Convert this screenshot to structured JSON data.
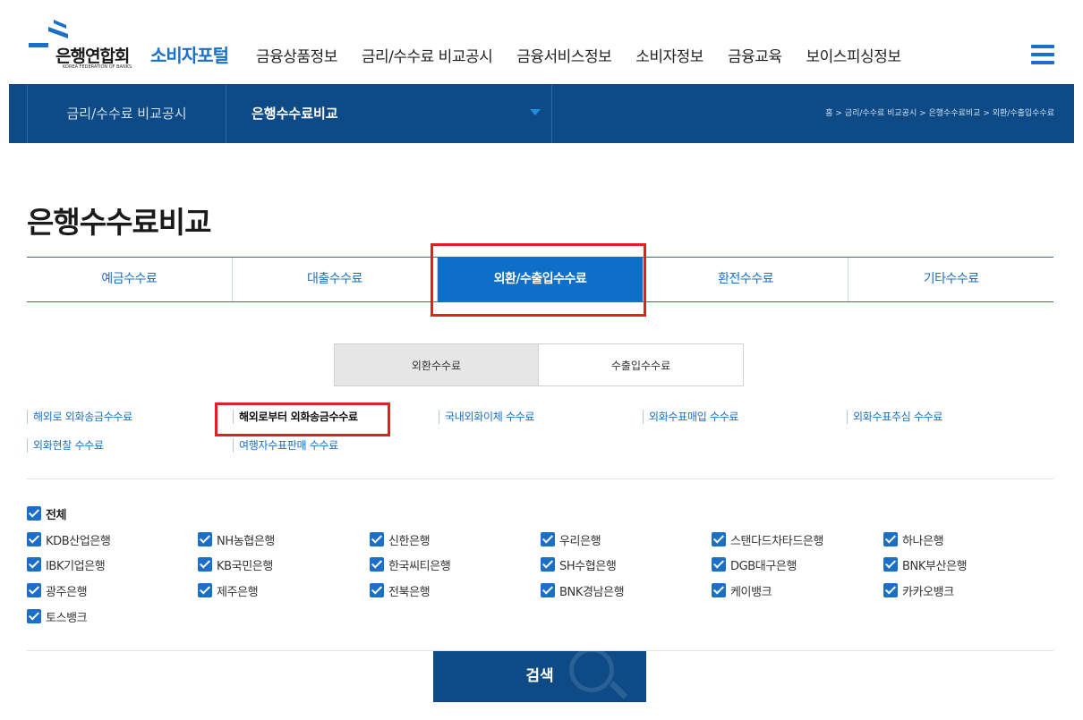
{
  "header": {
    "logo_korean": "은행연합회",
    "logo_english": "KOREA FEDERATION OF BANKS",
    "logo_portal": "소비자포털",
    "menu": [
      "금융상품정보",
      "금리/수수료 비교공시",
      "금융서비스정보",
      "소비자정보",
      "금융교육",
      "보이스피싱정보"
    ],
    "menu_icon": "hamburger-icon"
  },
  "subnav": {
    "section": "금리/수수료 비교공시",
    "subsection": "은행수수료비교",
    "breadcrumb": "홈 > 금리/수수료 비교공시 > 은행수수료비교 > 외환/수출입수수료"
  },
  "page_title": "은행수수료비교",
  "main_tabs": [
    {
      "label": "예금수수료",
      "active": false
    },
    {
      "label": "대출수수료",
      "active": false
    },
    {
      "label": "외환/수출입수수료",
      "active": true
    },
    {
      "label": "환전수수료",
      "active": false
    },
    {
      "label": "기타수수료",
      "active": false
    }
  ],
  "sub_tabs": [
    {
      "label": "외환수수료",
      "active": true
    },
    {
      "label": "수출입수수료",
      "active": false
    }
  ],
  "fee_links": [
    {
      "label": "해외로 외화송금수수료",
      "active": false
    },
    {
      "label": "해외로부터 외화송금수수료",
      "active": true
    },
    {
      "label": "국내외화이체 수수료",
      "active": false
    },
    {
      "label": "외화수표매입 수수료",
      "active": false
    },
    {
      "label": "외화수표추심 수수료",
      "active": false
    },
    {
      "label": "외화현찰 수수료",
      "active": false
    },
    {
      "label": "여행자수표판매 수수료",
      "active": false
    }
  ],
  "checkbox_all": {
    "label": "전체",
    "checked": true
  },
  "banks": [
    {
      "label": "KDB산업은행",
      "checked": true
    },
    {
      "label": "NH농협은행",
      "checked": true
    },
    {
      "label": "신한은행",
      "checked": true
    },
    {
      "label": "우리은행",
      "checked": true
    },
    {
      "label": "스탠다드차타드은행",
      "checked": true
    },
    {
      "label": "하나은행",
      "checked": true
    },
    {
      "label": "IBK기업은행",
      "checked": true
    },
    {
      "label": "KB국민은행",
      "checked": true
    },
    {
      "label": "한국씨티은행",
      "checked": true
    },
    {
      "label": "SH수협은행",
      "checked": true
    },
    {
      "label": "DGB대구은행",
      "checked": true
    },
    {
      "label": "BNK부산은행",
      "checked": true
    },
    {
      "label": "광주은행",
      "checked": true
    },
    {
      "label": "제주은행",
      "checked": true
    },
    {
      "label": "전북은행",
      "checked": true
    },
    {
      "label": "BNK경남은행",
      "checked": true
    },
    {
      "label": "케이뱅크",
      "checked": true
    },
    {
      "label": "카카오뱅크",
      "checked": true
    },
    {
      "label": "토스뱅크",
      "checked": true
    }
  ],
  "search_button": "검색",
  "colors": {
    "brand_blue": "#1c6fc7",
    "nav_dark_blue": "#0d4a86",
    "highlight_red": "#e31e24"
  }
}
